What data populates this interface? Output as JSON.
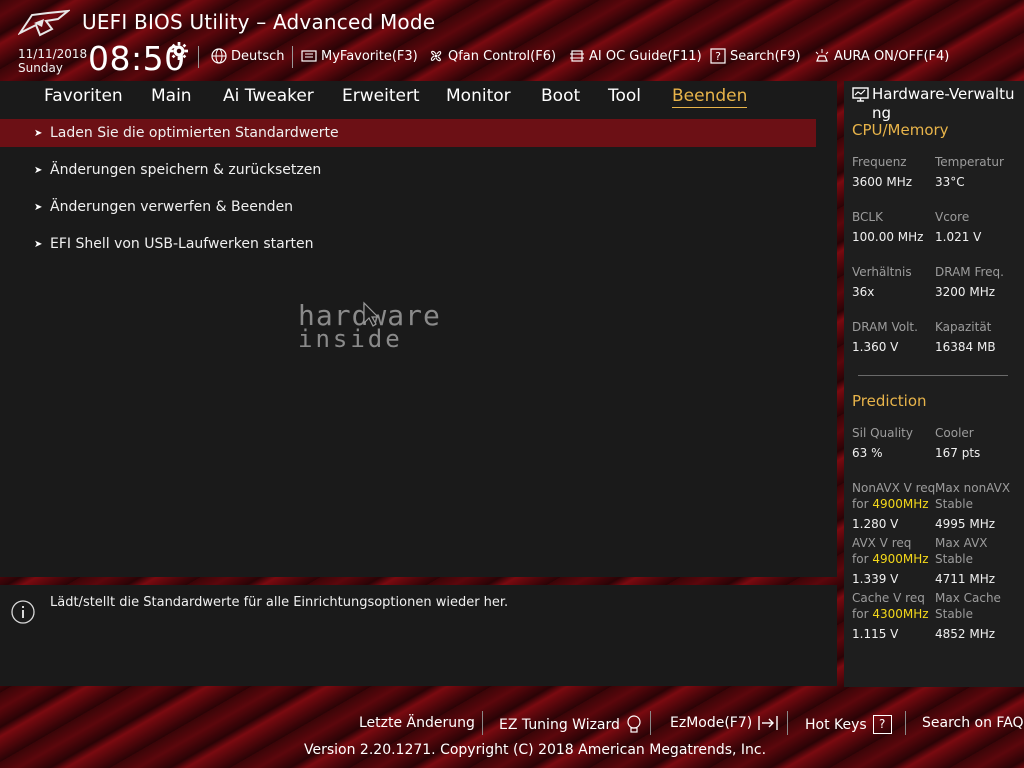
{
  "window": {
    "title": "UEFI BIOS Utility – Advanced Mode",
    "date": "11/11/2018",
    "day": "Sunday",
    "time": "08:50"
  },
  "toolbar": [
    {
      "label": "Deutsch",
      "icon": "globe-icon"
    },
    {
      "label": "MyFavorite(F3)",
      "icon": "favorite-list-icon"
    },
    {
      "label": "Qfan Control(F6)",
      "icon": "fan-icon"
    },
    {
      "label": "AI OC Guide(F11)",
      "icon": "ai-chip-icon"
    },
    {
      "label": "Search(F9)",
      "icon": "search-help-icon"
    },
    {
      "label": "AURA ON/OFF(F4)",
      "icon": "aura-light-icon"
    }
  ],
  "nav": {
    "tabs": [
      "Favoriten",
      "Main",
      "Ai Tweaker",
      "Erweitert",
      "Monitor",
      "Boot",
      "Tool",
      "Beenden"
    ],
    "active": "Beenden"
  },
  "menu": {
    "items": [
      "Laden Sie die optimierten Standardwerte",
      "Änderungen speichern & zurücksetzen",
      "Änderungen verwerfen & Beenden",
      "EFI Shell von USB-Laufwerken starten"
    ],
    "selected_index": 0
  },
  "help": {
    "text": "Lädt/stellt die Standardwerte für alle Einrichtungsoptionen wieder her."
  },
  "watermark": {
    "line1": "hardware",
    "line2": "inside"
  },
  "hw_monitor": {
    "title": "Hardware-Verwaltung",
    "cpu_section": "CPU/Memory",
    "cpu_pairs": [
      {
        "l_label": "Frequenz",
        "l_value": "3600 MHz",
        "r_label": "Temperatur",
        "r_value": "33°C"
      },
      {
        "l_label": "BCLK",
        "l_value": "100.00 MHz",
        "r_label": "Vcore",
        "r_value": "1.021 V"
      },
      {
        "l_label": "Verhältnis",
        "l_value": "36x",
        "r_label": "DRAM Freq.",
        "r_value": "3200 MHz"
      },
      {
        "l_label": "DRAM Volt.",
        "l_value": "1.360 V",
        "r_label": "Kapazität",
        "r_value": "16384 MB"
      }
    ],
    "prediction_section": "Prediction",
    "sil_quality": {
      "label": "Sil Quality",
      "value": "63 %"
    },
    "cooler": {
      "label": "Cooler",
      "value": "167 pts"
    },
    "pred_rows": [
      {
        "l_label": "NonAVX V req",
        "l_for": "for",
        "l_freq": "4900MHz",
        "l_value": "1.280 V",
        "r_label1": "Max nonAVX",
        "r_label2": "Stable",
        "r_value": "4995 MHz"
      },
      {
        "l_label": "AVX V req",
        "l_for": "for",
        "l_freq": "4900MHz",
        "l_value": "1.339 V",
        "r_label1": "Max AVX",
        "r_label2": "Stable",
        "r_value": "4711 MHz"
      },
      {
        "l_label": "Cache V req",
        "l_for": "for",
        "l_freq": "4300MHz",
        "l_value": "1.115 V",
        "r_label1": "Max Cache",
        "r_label2": "Stable",
        "r_value": "4852 MHz"
      }
    ]
  },
  "footer": {
    "last_change": "Letzte Änderung",
    "ez_tuning": "EZ Tuning Wizard",
    "ezmode": "EzMode(F7)",
    "hotkeys": "Hot Keys",
    "hotkeys_glyph": "?",
    "faq": "Search on FAQ",
    "version": "Version 2.20.1271. Copyright (C) 2018 American Megatrends, Inc."
  },
  "colors": {
    "accent": "#e8b44a",
    "selected_row": "#6c1015",
    "highlight_freq": "#f4d81a",
    "panel_bg": "#1a1a1a"
  }
}
